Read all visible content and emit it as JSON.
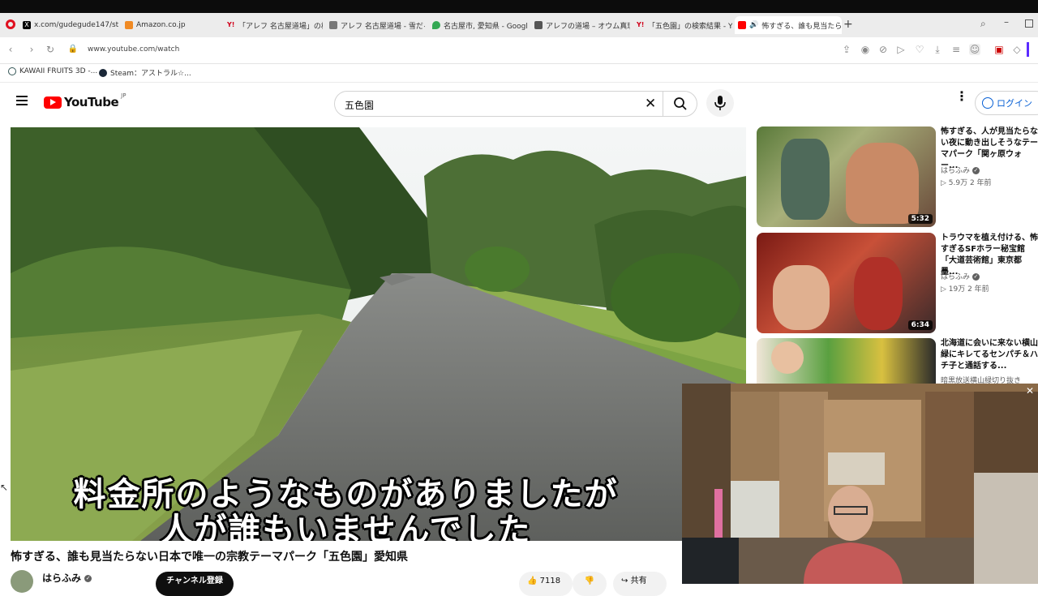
{
  "browser": {
    "tabs": [
      {
        "label": "x.com/gudegude147/stat",
        "color": "#000000"
      },
      {
        "label": "Amazon.co.jp",
        "color": "#f08a24"
      },
      {
        "label": "「アレフ 名古屋道場」の検索",
        "color": "#d0021b"
      },
      {
        "label": "アレフ 名古屋道場 - 雪だる",
        "color": "#666666"
      },
      {
        "label": "名古屋市, 愛知県 - Googl",
        "color": "#34a853"
      },
      {
        "label": "アレフの道場 – オウム真理教",
        "color": "#555555"
      },
      {
        "label": "「五色園」の検索結果 - Yah",
        "color": "#d0021b"
      },
      {
        "label": "怖すぎる、誰も見当たら",
        "color": "#ff0000"
      }
    ],
    "url": "www.youtube.com/watch",
    "bookmarks": [
      {
        "label": "KAWAII FRUITS 3D -..."
      },
      {
        "label": "Steam：アストラル☆..."
      }
    ]
  },
  "youtube": {
    "logo_text": "YouTube",
    "region": "JP",
    "search_value": "五色園",
    "login_label": "ログイン"
  },
  "video": {
    "caption_line1": "料金所のようなものがありましたが",
    "caption_line2": "人が誰もいませんでした",
    "title": "怖すぎる、誰も見当たらない日本で唯一の宗教テーマパーク「五色園」愛知県",
    "channel": "はらふみ",
    "subscribe_label": "チャンネル登録",
    "likes": "7118",
    "share_label": "共有"
  },
  "recommendations": [
    {
      "title": "怖すぎる、人が見当たらない夜に動き出しそうなテーマパーク「関ヶ原ウォー...",
      "channel": "はらふみ",
      "meta": "▷ 5.9万  2 年前",
      "duration": "5:32"
    },
    {
      "title": "トラウマを植え付ける、怖すぎるSFホラー秘宝館「大道芸術館」東京都墨...",
      "channel": "はらふみ",
      "meta": "▷ 19万  2 年前",
      "duration": "6:34"
    },
    {
      "title": "北海道に会いに来ない横山緑にキレてるセンパチ＆ハチ子と通話する...",
      "channel": "暗黒放送横山緑切り抜き",
      "meta": "",
      "duration": ""
    }
  ]
}
